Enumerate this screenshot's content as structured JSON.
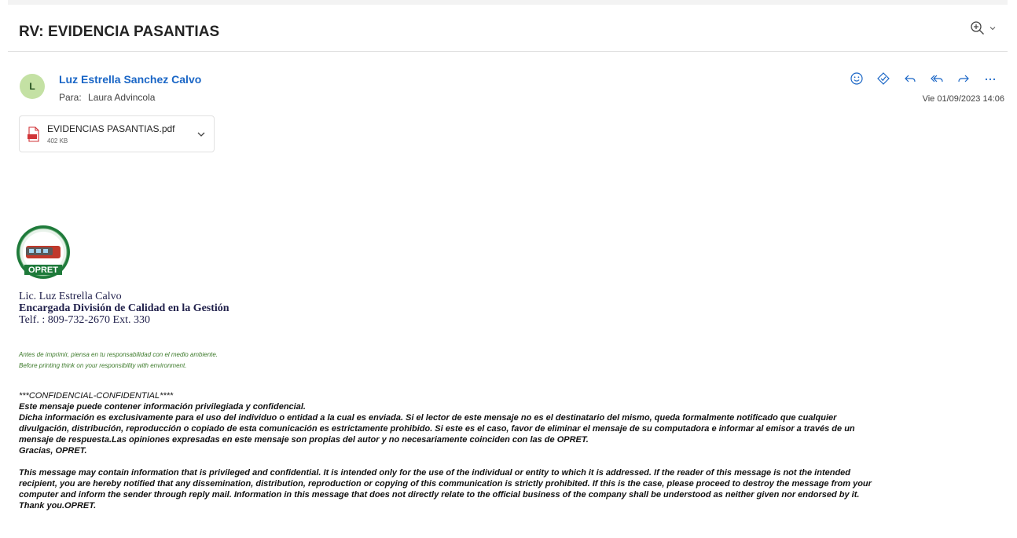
{
  "email": {
    "subject": "RV: EVIDENCIA PASANTIAS",
    "sender_name": "Luz Estrella Sanchez Calvo",
    "avatar_initial": "L",
    "to_label": "Para:",
    "to_name": "Laura Advincola",
    "date": "Vie 01/09/2023 14:06"
  },
  "icons": {
    "zoom": "zoom-in-icon",
    "emoji": "smiley-icon",
    "immersive": "immersive-reader-icon",
    "reply": "reply-icon",
    "reply_all": "reply-all-icon",
    "forward": "forward-icon",
    "more": "more-icon"
  },
  "colors": {
    "accent": "#1a66c6",
    "avatar_bg": "#c4e1a4",
    "pdf_red": "#d13438",
    "eco_green": "#3c7a2a"
  },
  "attachment": {
    "name": "EVIDENCIAS PASANTIAS.pdf",
    "size": "402 KB"
  },
  "logo": {
    "text": "OPRET"
  },
  "signature": {
    "name": "Lic. Luz Estrella Calvo",
    "title": "Encargada División de Calidad en la Gestión",
    "phone": "Telf.  : 809-732-2670 Ext. 330"
  },
  "eco_notice": {
    "es": "Antes de imprimir, piensa en tu responsabilidad con el medio ambiente.",
    "en": "Before printing think on your responsibility with environment."
  },
  "confidential": {
    "header": "***CONFIDENCIAL-CONFIDENTIAL****",
    "es_line1": "Este mensaje puede contener información privilegiada y confidencial.",
    "es_line2": "Dicha información es exclusivamente para el uso del individuo o entidad a la cual es enviada. Si el lector de este mensaje no es el destinatario del mismo, queda formalmente notificado que cualquier",
    "es_line3": "divulgación, distribución, reproducción o copiado de esta comunicación es estrictamente prohibido. Si este es el caso, favor de eliminar el mensaje de su computadora e informar al emisor a través de un",
    "es_line4": "mensaje de respuesta.Las opiniones expresadas en este mensaje son propias del autor y no necesariamente coinciden con las de OPRET.",
    "es_line5": "Gracias, OPRET.",
    "en_line1": "This message may contain information that is privileged and confidential. It is intended only for the use of the individual or entity to which it is addressed. If the reader of this message is not the intended",
    "en_line2": "recipient, you are hereby notified that any dissemination, distribution, reproduction or copying of this communication is strictly prohibited. If this is the case, please proceed to destroy the message from your",
    "en_line3": "computer and inform the sender through reply mail. Information in this message that does not directly relate to the official business of the company shall be understood as neither given nor endorsed by it.",
    "en_line4": "Thank you.OPRET."
  }
}
